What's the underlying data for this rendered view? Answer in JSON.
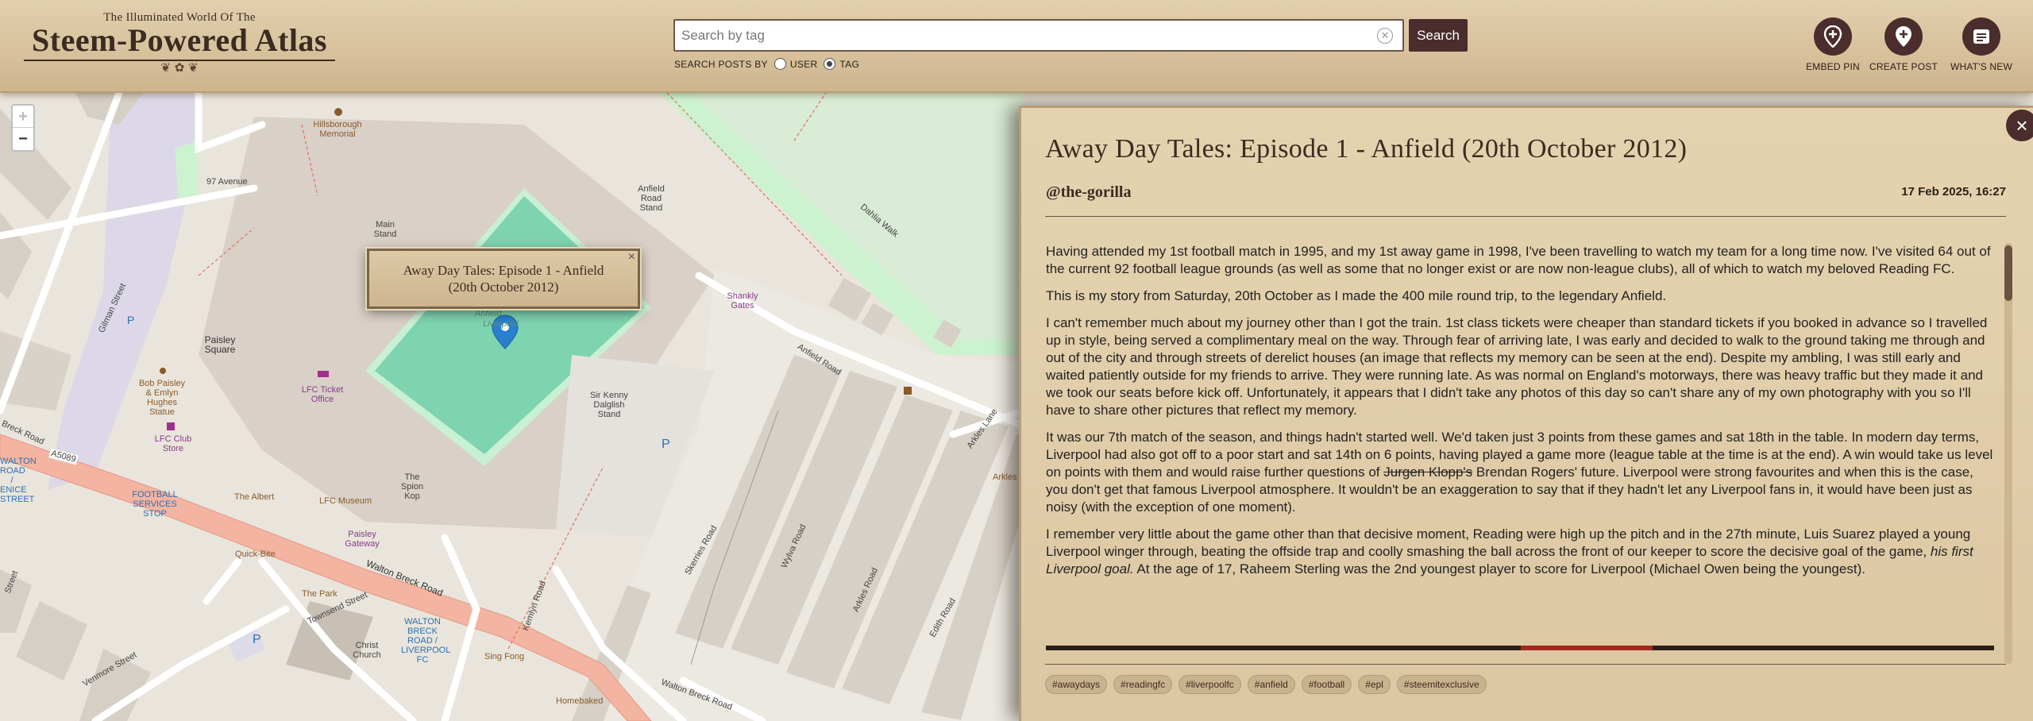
{
  "header": {
    "logo_subtitle": "The Illuminated World Of The",
    "logo_title": "Steem-Powered Atlas",
    "logo_flourish": "❦ ✿ ❦",
    "search": {
      "placeholder": "Search by tag",
      "value": ""
    },
    "search_button_label": "Search",
    "search_posts_by_label": "SEARCH POSTS BY",
    "search_options": {
      "user": "USER",
      "tag": "TAG",
      "selected": "TAG"
    },
    "actions": [
      {
        "label": "EMBED PIN",
        "icon": "pin-plus-icon"
      },
      {
        "label": "CREATE POST",
        "icon": "pin-add-icon"
      },
      {
        "label": "WHAT'S NEW",
        "icon": "news-icon"
      }
    ]
  },
  "map": {
    "zoom_in": "+",
    "zoom_out": "−",
    "labels": {
      "hillsborough": "Hillsborough Memorial",
      "97_avenue": "97 Avenue",
      "main_stand": "Main Stand",
      "anfield_road_stand": "Anfield Road Stand",
      "dahlia_walk": "Dahlia Walk",
      "gilman_street": "Gilman Street",
      "paisley_square": "Paisley Square",
      "anfield": "Anfield",
      "liverpool": "Liverpool",
      "shankly_gates": "Shankly Gates",
      "anfield_road": "Anfield Road",
      "bob_paisley": "Bob Paisley & Emlyn Hughes Statue",
      "lfc_ticket_office": "LFC Ticket Office",
      "lfc_club_store": "LFC Club Store",
      "sir_kenny": "Sir Kenny Dalglish Stand",
      "arkles_lane": "Arkles Lane",
      "a5089": "A5089",
      "walton_road_street": "WALTON ROAD / ENICE STREET",
      "football_services": "FOOTBALL SERVICES STOP",
      "the_albert": "The Albert",
      "lfc_museum": "LFC Museum",
      "spion_kop": "The Spion Kop",
      "skerries_road": "Skerries Road",
      "wylva_road": "Wylva Road",
      "arkles_road": "Arkles Road",
      "edith_road": "Edith Road",
      "paisley_gateway": "Paisley Gateway",
      "quick_bite": "Quick-Bite",
      "walton_breck_road": "Walton Breck Road",
      "the_park": "The Park",
      "townsend_street": "Townsend Street",
      "kemlyn_road": "Kemlyn Road",
      "christ_church": "Christ Church",
      "walton_breck_stop": "WALTON BRECK ROAD / LIVERPOOL FC",
      "sing_fong": "Sing Fong",
      "venmore_street": "Venmore Street",
      "homebaked": "Homebaked",
      "walton_breck_road_2": "Walton Breck Road",
      "breck_road": "Breck Road",
      "street": "Street",
      "arkles": "Arkles",
      "p1": "P",
      "p2": "P",
      "p3": "P"
    },
    "popup": {
      "title": "Away Day Tales: Episode 1 - Anfield (20th October 2012)",
      "close": "×"
    }
  },
  "panel": {
    "close": "×",
    "title": "Away Day Tales: Episode 1 - Anfield (20th October 2012)",
    "author": "@the-gorilla",
    "date": "17 Feb 2025, 16:27",
    "paragraphs": {
      "p1": "Having attended my 1st football match in 1995, and my 1st away game in 1998, I've been travelling to watch my team for a long time now. I've visited 64 out of the current 92 football league grounds (as well as some that no longer exist or are now non-league clubs), all of which to watch my beloved Reading FC.",
      "p2": "This is my story from Saturday, 20th October as I made the 400 mile round trip, to the legendary Anfield.",
      "p3": "I can't remember much about my journey other than I got the train. 1st class tickets were cheaper than standard tickets if you booked in advance so I travelled up in style, being served a complimentary meal on the way. Through fear of arriving late, I was early and decided to walk to the ground taking me through and out of the city and through streets of derelict houses (an image that reflects my memory can be seen at the end). Despite my ambling, I was still early and waited patiently outside for my friends to arrive. They were running late. As was normal on England's motorways, there was heavy traffic but they made it and we took our seats before kick off. Unfortunately, it appears that I didn't take any photos of this day so can't share any of my own photography with you so I'll have to share other pictures that reflect my memory.",
      "p4a": "It was our 7th match of the season, and things hadn't started well. We'd taken just 3 points from these games and sat 18th in the table. In modern day terms, Liverpool had also got off to a poor start and sat 14th on 6 points, having played a game more (league table at the time is at the end). A win would take us level on points with them and would raise further questions of ",
      "p4_strike": "Jurgen Klopp's",
      "p4b": " Brendan Rogers' future. Liverpool were strong favourites and when this is the case, you don't get that famous Liverpool atmosphere. It wouldn't be an exaggeration to say that if they hadn't let any Liverpool fans in, it would have been just as noisy (with the exception of one moment).",
      "p5a": "I remember very little about the game other than that decisive moment, Reading were high up the pitch and in the 27th minute, Luis Suarez played a young Liverpool winger through, beating the offside trap and coolly smashing the ball across the front of our keeper to score the decisive goal of the game, ",
      "p5_em": "his first Liverpool goal.",
      "p5b": " At the age of 17, Raheem Sterling was the 2nd youngest player to score for Liverpool (Michael Owen being the youngest)."
    },
    "tags": [
      "#awaydays",
      "#readingfc",
      "#liverpoolfc",
      "#anfield",
      "#football",
      "#epl",
      "#steemitexclusive"
    ]
  }
}
